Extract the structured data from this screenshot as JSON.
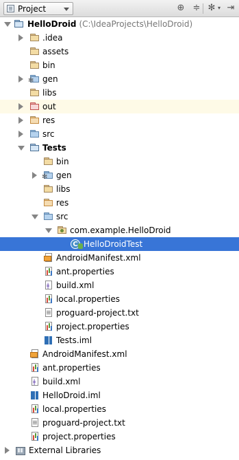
{
  "header": {
    "view_selector": "Project"
  },
  "tree": {
    "root": {
      "label": "HelloDroid",
      "path": "(C:\\IdeaProjects\\HelloDroid)"
    },
    "idea": ".idea",
    "assets": "assets",
    "bin": "bin",
    "gen": "gen",
    "libs": "libs",
    "out": "out",
    "res": "res",
    "src": "src",
    "tests": {
      "label": "Tests",
      "bin": "bin",
      "gen": "gen",
      "libs": "libs",
      "res": "res",
      "src": "src",
      "package": "com.example.HelloDroid",
      "class": "HelloDroidTest",
      "manifest": "AndroidManifest.xml",
      "ant": "ant.properties",
      "build": "build.xml",
      "local": "local.properties",
      "proguard": "proguard-project.txt",
      "project": "project.properties",
      "iml": "Tests.iml"
    },
    "manifest": "AndroidManifest.xml",
    "ant": "ant.properties",
    "build": "build.xml",
    "iml": "HelloDroid.iml",
    "local": "local.properties",
    "proguard": "proguard-project.txt",
    "project": "project.properties",
    "external": "External Libraries"
  }
}
